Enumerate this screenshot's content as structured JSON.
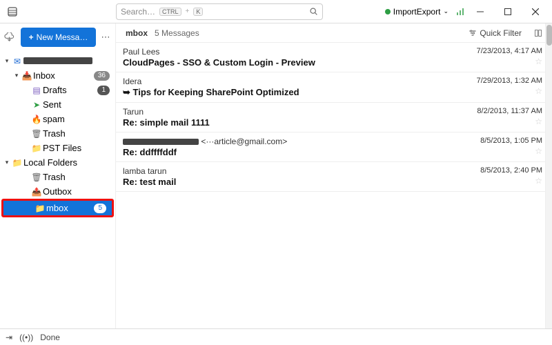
{
  "titlebar": {
    "search_placeholder": "Search…",
    "kbd1": "CTRL",
    "kbd2": "K",
    "import_export": "ImportExport"
  },
  "sidebar": {
    "new_message": "New Messa…",
    "account_label": "————————",
    "inbox": {
      "label": "Inbox",
      "count": "36"
    },
    "drafts": {
      "label": "Drafts",
      "count": "1"
    },
    "sent": {
      "label": "Sent"
    },
    "spam": {
      "label": "spam"
    },
    "trash": {
      "label": "Trash"
    },
    "pst": {
      "label": "PST Files"
    },
    "local": {
      "label": "Local Folders"
    },
    "ltrash": {
      "label": "Trash"
    },
    "outbox": {
      "label": "Outbox"
    },
    "mbox": {
      "label": "mbox",
      "count": "5"
    }
  },
  "header": {
    "folder": "mbox",
    "count": "5 Messages",
    "quick_filter": "Quick Filter"
  },
  "messages": [
    {
      "sender": "Paul Lees",
      "subject": "CloudPages - SSO & Custom Login - Preview",
      "date": "7/23/2013, 4:17 AM"
    },
    {
      "sender": "Idera",
      "subject": "Tips for Keeping SharePoint Optimized",
      "tag": "➥",
      "date": "7/29/2013, 1:32 AM"
    },
    {
      "sender": "Tarun",
      "subject": "Re: simple mail 1111",
      "date": "8/2/2013, 11:37 AM"
    },
    {
      "sender": "——— <···article@gmail.com>",
      "subject": "Re: ddffffddf",
      "date": "8/5/2013, 1:05 PM",
      "redacted": true
    },
    {
      "sender": "lamba tarun",
      "subject": "Re: test mail",
      "date": "8/5/2013, 2:40 PM"
    }
  ],
  "status": {
    "done": "Done"
  }
}
